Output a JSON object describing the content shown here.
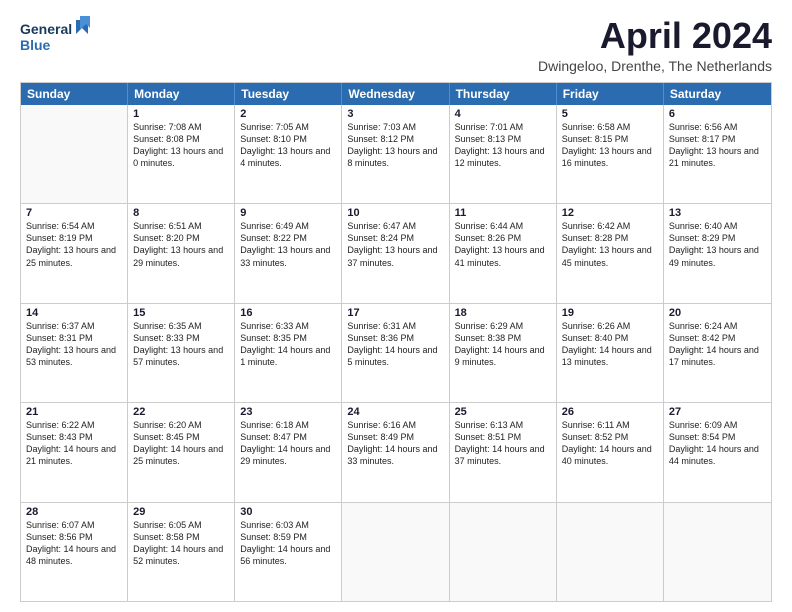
{
  "logo": {
    "line1": "General",
    "line2": "Blue"
  },
  "title": "April 2024",
  "location": "Dwingeloo, Drenthe, The Netherlands",
  "days_of_week": [
    "Sunday",
    "Monday",
    "Tuesday",
    "Wednesday",
    "Thursday",
    "Friday",
    "Saturday"
  ],
  "weeks": [
    [
      {
        "day": "",
        "empty": true
      },
      {
        "day": "1",
        "sunrise": "7:08 AM",
        "sunset": "8:08 PM",
        "daylight": "13 hours and 0 minutes."
      },
      {
        "day": "2",
        "sunrise": "7:05 AM",
        "sunset": "8:10 PM",
        "daylight": "13 hours and 4 minutes."
      },
      {
        "day": "3",
        "sunrise": "7:03 AM",
        "sunset": "8:12 PM",
        "daylight": "13 hours and 8 minutes."
      },
      {
        "day": "4",
        "sunrise": "7:01 AM",
        "sunset": "8:13 PM",
        "daylight": "13 hours and 12 minutes."
      },
      {
        "day": "5",
        "sunrise": "6:58 AM",
        "sunset": "8:15 PM",
        "daylight": "13 hours and 16 minutes."
      },
      {
        "day": "6",
        "sunrise": "6:56 AM",
        "sunset": "8:17 PM",
        "daylight": "13 hours and 21 minutes."
      }
    ],
    [
      {
        "day": "7",
        "sunrise": "6:54 AM",
        "sunset": "8:19 PM",
        "daylight": "13 hours and 25 minutes."
      },
      {
        "day": "8",
        "sunrise": "6:51 AM",
        "sunset": "8:20 PM",
        "daylight": "13 hours and 29 minutes."
      },
      {
        "day": "9",
        "sunrise": "6:49 AM",
        "sunset": "8:22 PM",
        "daylight": "13 hours and 33 minutes."
      },
      {
        "day": "10",
        "sunrise": "6:47 AM",
        "sunset": "8:24 PM",
        "daylight": "13 hours and 37 minutes."
      },
      {
        "day": "11",
        "sunrise": "6:44 AM",
        "sunset": "8:26 PM",
        "daylight": "13 hours and 41 minutes."
      },
      {
        "day": "12",
        "sunrise": "6:42 AM",
        "sunset": "8:28 PM",
        "daylight": "13 hours and 45 minutes."
      },
      {
        "day": "13",
        "sunrise": "6:40 AM",
        "sunset": "8:29 PM",
        "daylight": "13 hours and 49 minutes."
      }
    ],
    [
      {
        "day": "14",
        "sunrise": "6:37 AM",
        "sunset": "8:31 PM",
        "daylight": "13 hours and 53 minutes."
      },
      {
        "day": "15",
        "sunrise": "6:35 AM",
        "sunset": "8:33 PM",
        "daylight": "13 hours and 57 minutes."
      },
      {
        "day": "16",
        "sunrise": "6:33 AM",
        "sunset": "8:35 PM",
        "daylight": "14 hours and 1 minute."
      },
      {
        "day": "17",
        "sunrise": "6:31 AM",
        "sunset": "8:36 PM",
        "daylight": "14 hours and 5 minutes."
      },
      {
        "day": "18",
        "sunrise": "6:29 AM",
        "sunset": "8:38 PM",
        "daylight": "14 hours and 9 minutes."
      },
      {
        "day": "19",
        "sunrise": "6:26 AM",
        "sunset": "8:40 PM",
        "daylight": "14 hours and 13 minutes."
      },
      {
        "day": "20",
        "sunrise": "6:24 AM",
        "sunset": "8:42 PM",
        "daylight": "14 hours and 17 minutes."
      }
    ],
    [
      {
        "day": "21",
        "sunrise": "6:22 AM",
        "sunset": "8:43 PM",
        "daylight": "14 hours and 21 minutes."
      },
      {
        "day": "22",
        "sunrise": "6:20 AM",
        "sunset": "8:45 PM",
        "daylight": "14 hours and 25 minutes."
      },
      {
        "day": "23",
        "sunrise": "6:18 AM",
        "sunset": "8:47 PM",
        "daylight": "14 hours and 29 minutes."
      },
      {
        "day": "24",
        "sunrise": "6:16 AM",
        "sunset": "8:49 PM",
        "daylight": "14 hours and 33 minutes."
      },
      {
        "day": "25",
        "sunrise": "6:13 AM",
        "sunset": "8:51 PM",
        "daylight": "14 hours and 37 minutes."
      },
      {
        "day": "26",
        "sunrise": "6:11 AM",
        "sunset": "8:52 PM",
        "daylight": "14 hours and 40 minutes."
      },
      {
        "day": "27",
        "sunrise": "6:09 AM",
        "sunset": "8:54 PM",
        "daylight": "14 hours and 44 minutes."
      }
    ],
    [
      {
        "day": "28",
        "sunrise": "6:07 AM",
        "sunset": "8:56 PM",
        "daylight": "14 hours and 48 minutes."
      },
      {
        "day": "29",
        "sunrise": "6:05 AM",
        "sunset": "8:58 PM",
        "daylight": "14 hours and 52 minutes."
      },
      {
        "day": "30",
        "sunrise": "6:03 AM",
        "sunset": "8:59 PM",
        "daylight": "14 hours and 56 minutes."
      },
      {
        "day": "",
        "empty": true
      },
      {
        "day": "",
        "empty": true
      },
      {
        "day": "",
        "empty": true
      },
      {
        "day": "",
        "empty": true
      }
    ]
  ]
}
